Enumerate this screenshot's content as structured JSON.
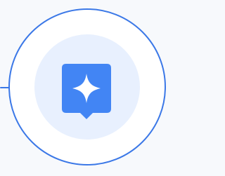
{
  "colors": {
    "accent": "#3b78e7",
    "inner_fill": "#e8f0fe",
    "outer_fill": "#ffffff",
    "background": "#f7f9fc",
    "icon_fill": "#4285f4",
    "sparkle": "#ffffff"
  },
  "icon": {
    "name": "sparkle-chat-bubble-icon"
  }
}
